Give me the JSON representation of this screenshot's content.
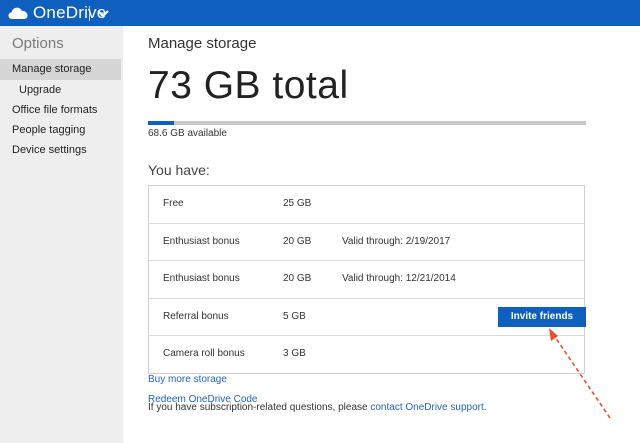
{
  "app": {
    "name": "OneDrive"
  },
  "colors": {
    "brand": "#0f5fbf",
    "link": "#1f62c3",
    "annotation_arrow": "#e8502a"
  },
  "sidebar": {
    "title": "Options",
    "items": [
      {
        "label": "Manage storage",
        "active": true
      },
      {
        "label": "Upgrade",
        "sub": true
      },
      {
        "label": "Office file formats"
      },
      {
        "label": "People tagging"
      },
      {
        "label": "Device settings"
      }
    ]
  },
  "main": {
    "heading": "Manage storage",
    "total": "73 GB total",
    "usage_fraction": 0.06,
    "available": "68.6 GB available",
    "you_have": "You have:",
    "rows": [
      {
        "name": "Free",
        "size": "25 GB",
        "valid": ""
      },
      {
        "name": "Enthusiast bonus",
        "size": "20 GB",
        "valid": "Valid through: 2/19/2017"
      },
      {
        "name": "Enthusiast bonus",
        "size": "20 GB",
        "valid": "Valid through: 12/21/2014"
      },
      {
        "name": "Referral bonus",
        "size": "5 GB",
        "valid": "",
        "button": "Invite friends"
      },
      {
        "name": "Camera roll bonus",
        "size": "3 GB",
        "valid": ""
      }
    ],
    "buy_more": "Buy more storage",
    "redeem": "Redeem OneDrive Code",
    "footer_prefix": "If you have subscription-related questions, please ",
    "footer_link": "contact OneDrive support",
    "footer_suffix": "."
  },
  "icons": {
    "logo": "cloud-icon",
    "menu": "chevron-down-icon",
    "annotation": "dashed-arrow-icon"
  }
}
